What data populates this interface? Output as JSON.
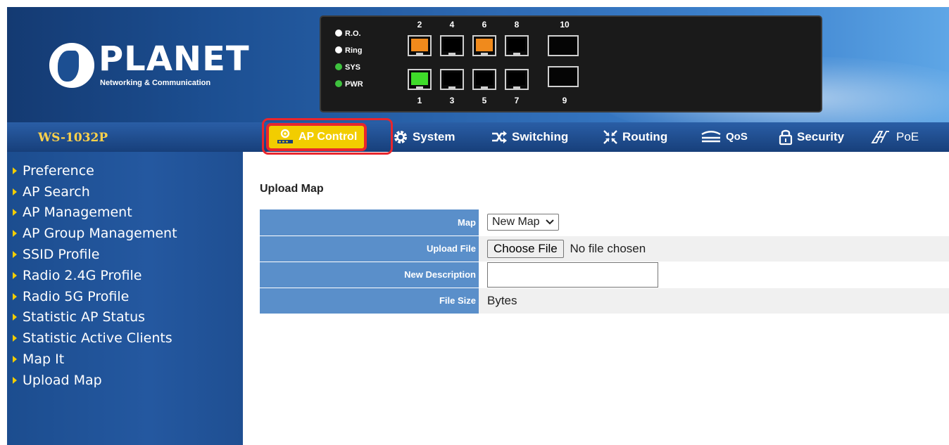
{
  "brand": {
    "name": "PLANET",
    "tagline": "Networking & Communication"
  },
  "device_panel": {
    "leds": [
      "R.O.",
      "Ring",
      "SYS",
      "PWR"
    ],
    "ports_top": [
      "2",
      "4",
      "6",
      "8",
      "10"
    ],
    "ports_bottom": [
      "1",
      "3",
      "5",
      "7",
      "9"
    ]
  },
  "model": "WS-1032P",
  "nav": {
    "ap_control": "AP Control",
    "system": "System",
    "switching": "Switching",
    "routing": "Routing",
    "qos": "QoS",
    "security": "Security",
    "poe": "PoE"
  },
  "sidebar": {
    "items": [
      "Preference",
      "AP Search",
      "AP Management",
      "AP Group Management",
      "SSID Profile",
      "Radio 2.4G Profile",
      "Radio 5G Profile",
      "Statistic AP Status",
      "Statistic Active Clients",
      "Map It",
      "Upload Map"
    ]
  },
  "main": {
    "title": "Upload Map",
    "form": {
      "map_label": "Map",
      "map_value": "New Map",
      "upload_label": "Upload File",
      "choose_file": "Choose File",
      "no_file": "No file chosen",
      "desc_label": "New Description",
      "desc_value": "",
      "size_label": "File Size",
      "size_value": "Bytes"
    }
  },
  "colors": {
    "accent_yellow": "#f2cd00",
    "highlight_red": "#e8262d",
    "label_blue": "#5a8fca"
  }
}
